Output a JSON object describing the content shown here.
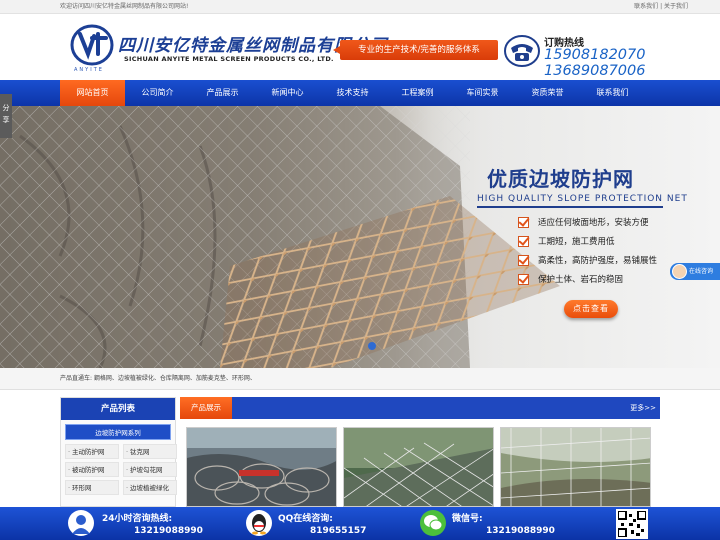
{
  "topbar": {
    "welcome": "欢迎访问四川安亿特金属丝网制品有限公司网站!",
    "links": "联系我们 | 关于我们"
  },
  "header": {
    "brand_cn": "四川安亿特金属丝网制品有限公司",
    "brand_en": "SICHUAN ANYITE METAL SCREEN PRODUCTS CO., LTD.",
    "brand_small": "ANYITE",
    "slogan": "专业的生产技术/完善的服务体系",
    "hotline_title": "订购热线",
    "hotline_numbers": [
      "15908182070",
      "13689087006"
    ]
  },
  "nav": {
    "items": [
      "网站首页",
      "公司简介",
      "产品展示",
      "新闻中心",
      "技术支持",
      "工程案例",
      "车间实景",
      "资质荣誉",
      "联系我们"
    ],
    "active_index": 0
  },
  "banner": {
    "title": "优质边坡防护网",
    "subtitle": "HIGH QUALITY SLOPE PROTECTION NET",
    "features": [
      "适应任何坡面地形，安装方便",
      "工期短，施工费用低",
      "高柔性，高防护强度，易铺展性",
      "保护土体、岩石的稳固"
    ],
    "button": "点击查看"
  },
  "share_tab": "分享",
  "online_service": "在线咨询",
  "keywords": "产品直通车: 鋼格网、边坡植被绿化、仓库隔离网、加筋麦克垫、环形网、",
  "categories": {
    "title": "产品列表",
    "subtitle": "边坡防护网系列",
    "items": [
      "主动防护网",
      "钛克网",
      "被动防护网",
      "护坡勾花网",
      "环形网",
      "边坡植被绿化"
    ]
  },
  "products": {
    "tab": "产品展示",
    "more": "更多>>"
  },
  "footer": {
    "phone_label": "24小时咨询热线:",
    "phone_number": "13219088990",
    "qq_label": "QQ在线咨询:",
    "qq_number": "819655157",
    "wechat_label": "微信号:",
    "wechat_number": "13219088990"
  },
  "colors": {
    "nav_blue": "#0c34a8",
    "accent_orange": "#e5470c",
    "brand_blue": "#1c3f95",
    "hotline_blue": "#1a63c6"
  }
}
